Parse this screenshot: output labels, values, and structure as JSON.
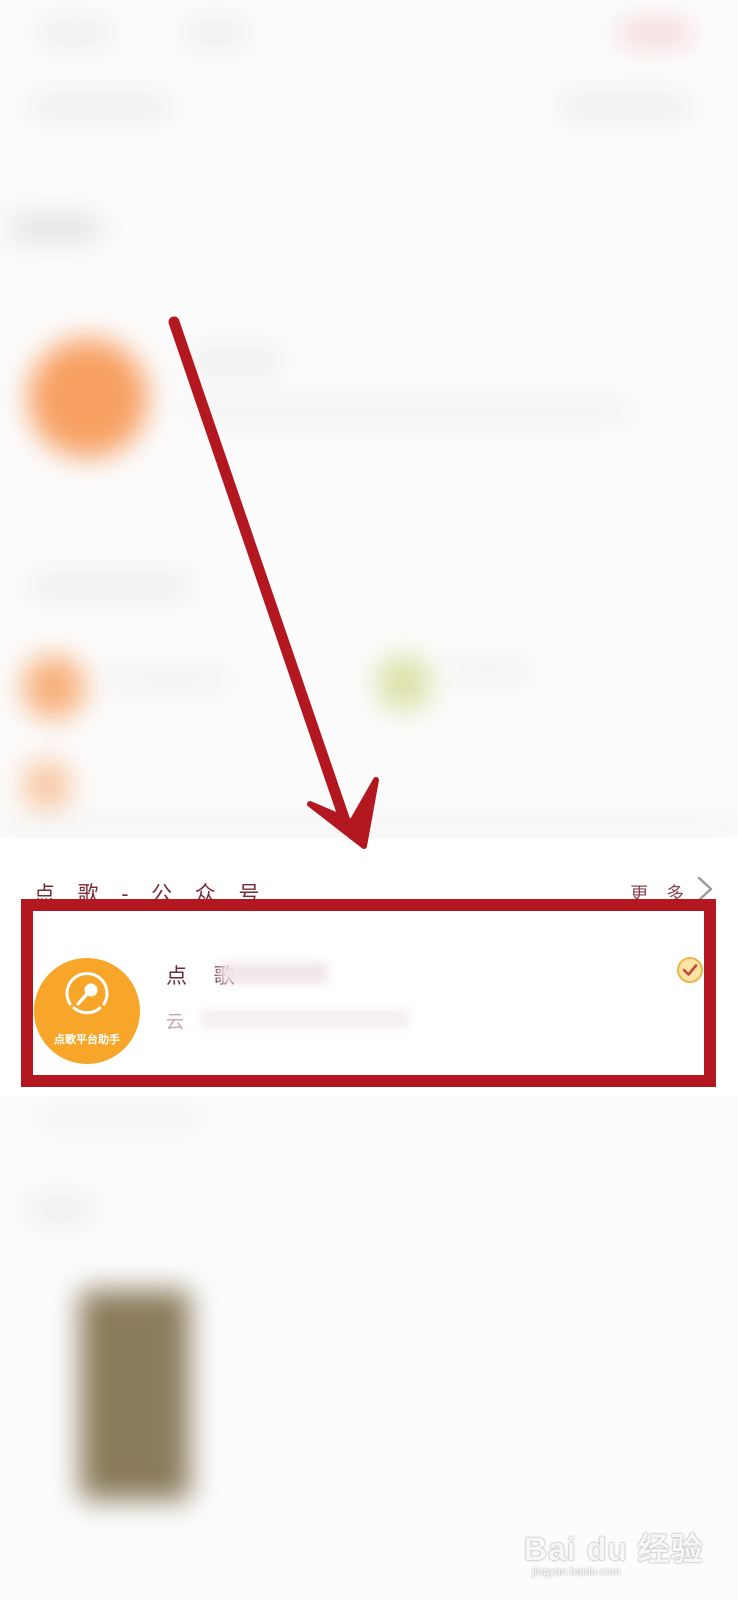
{
  "section": {
    "title": "点 歌 - 公 众 号",
    "more_label": "更 多"
  },
  "account": {
    "name": "点 歌",
    "description": "云 ",
    "avatar_caption": "点歌平台助手",
    "verified": true,
    "avatar_color": "#f7a62a"
  },
  "annotation": {
    "color": "#b3171f"
  },
  "watermark": {
    "text": "Bai du 经验",
    "url": "jingyan.baidu.com"
  },
  "icons": [
    "chevron-right-icon",
    "verified-check-icon",
    "microphone-icon",
    "baidu-paw-icon"
  ]
}
